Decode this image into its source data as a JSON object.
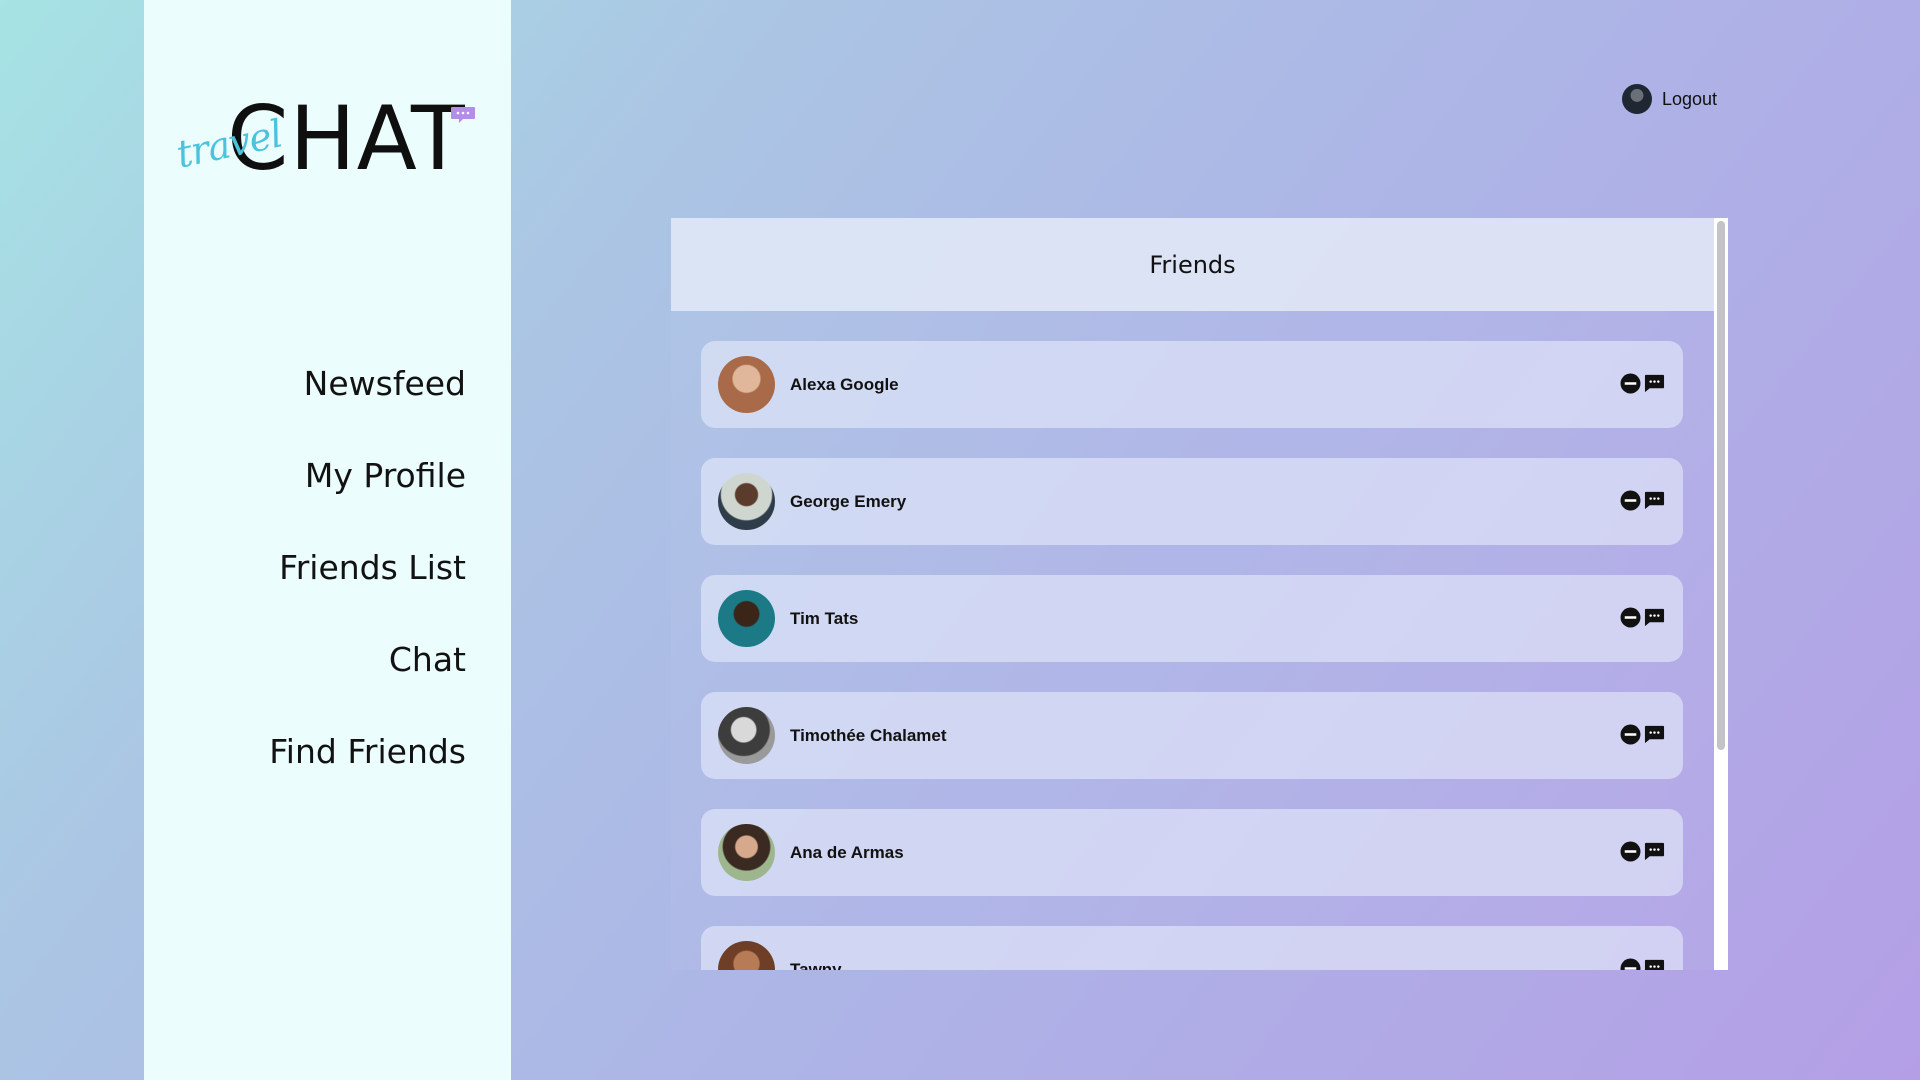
{
  "app": {
    "logo_main": "CHAT",
    "logo_script": "travel"
  },
  "sidebar": {
    "items": [
      {
        "label": "Newsfeed"
      },
      {
        "label": "My Profile"
      },
      {
        "label": "Friends List"
      },
      {
        "label": "Chat"
      },
      {
        "label": "Find Friends"
      }
    ]
  },
  "header": {
    "logout_label": "Logout"
  },
  "friends_panel": {
    "title": "Friends",
    "friends": [
      {
        "name": "Alexa Google",
        "avatar_color": "#c98a66"
      },
      {
        "name": "George Emery",
        "avatar_color": "#6f7d6f"
      },
      {
        "name": "Tim Tats",
        "avatar_color": "#1c7a86"
      },
      {
        "name": "Timothée Chalamet",
        "avatar_color": "#8a8a8a"
      },
      {
        "name": "Ana de Armas",
        "avatar_color": "#7a9a6e"
      },
      {
        "name": "Tawny",
        "avatar_color": "#a9714f"
      }
    ]
  },
  "icons": {
    "remove": "minus-circle-icon",
    "message": "chat-bubble-icon"
  },
  "colors": {
    "sidebar_bg": "#ebfdfd",
    "logo_script": "#4bc3dd",
    "logo_bubble": "#b48ee6"
  }
}
